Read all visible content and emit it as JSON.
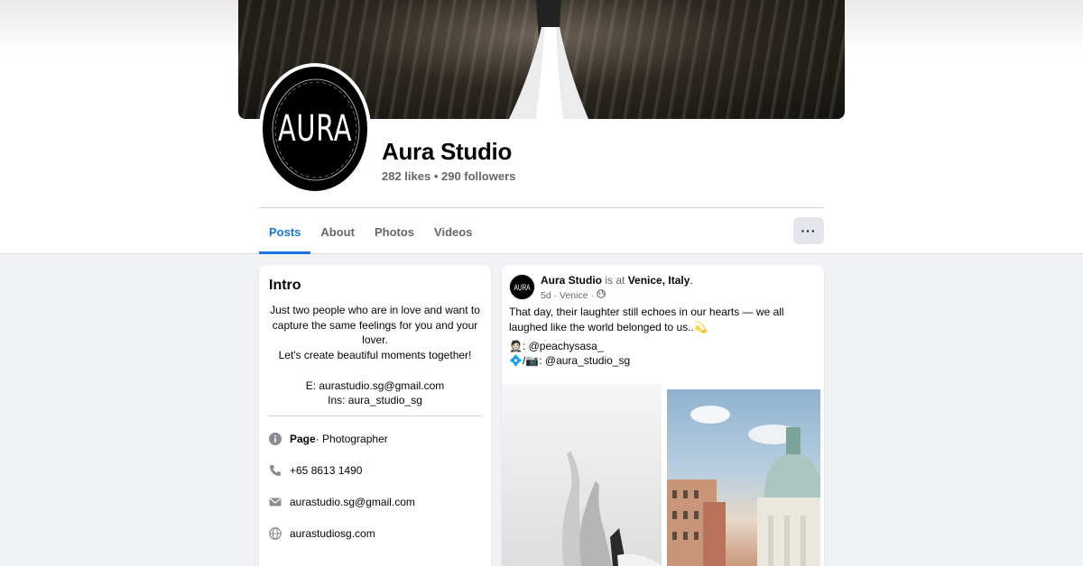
{
  "page": {
    "name": "Aura Studio",
    "stats": "282 likes • 290 followers",
    "avatar_text": "AURA"
  },
  "tabs": [
    {
      "label": "Posts",
      "active": true
    },
    {
      "label": "About",
      "active": false
    },
    {
      "label": "Photos",
      "active": false
    },
    {
      "label": "Videos",
      "active": false
    }
  ],
  "more_label": "···",
  "intro": {
    "title": "Intro",
    "bio_lines": [
      "Just two people who are in love and want to",
      "capture the same feelings for you and your",
      "lover.",
      "Let's create beautiful moments together!",
      "",
      "E: aurastudio.sg@gmail.com",
      "Ins: aura_studio_sg"
    ],
    "details": [
      {
        "icon": "info-icon",
        "bold": "Page",
        "text": " · Photographer"
      },
      {
        "icon": "phone-icon",
        "bold": "",
        "text": "+65 8613 1490"
      },
      {
        "icon": "mail-icon",
        "bold": "",
        "text": "aurastudio.sg@gmail.com"
      },
      {
        "icon": "globe-icon",
        "bold": "",
        "text": "aurastudiosg.com"
      }
    ]
  },
  "post": {
    "author": "Aura Studio",
    "is_at": " is at ",
    "location": "Venice, Italy",
    "time": "5d",
    "place": "Venice",
    "avatar_text": "AURA",
    "text": "That day, their laughter still echoes in our hearts — we all laughed like the world belonged to us..💫",
    "credit_1": "🤵🏻: @peachysasa_",
    "credit_2": "💠/📷: @aura_studio_sg"
  },
  "colors": {
    "accent": "#1b74e4",
    "muted": "#65676b",
    "background": "#f0f2f5"
  }
}
